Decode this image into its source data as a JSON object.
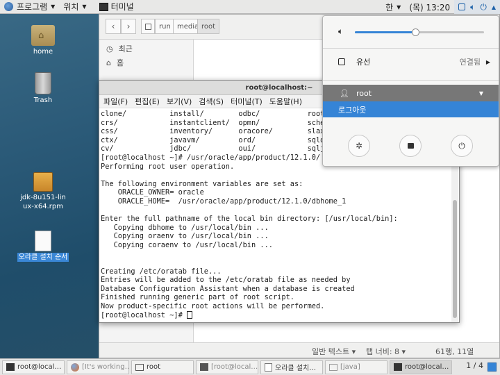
{
  "topbar": {
    "applications": "프로그램",
    "places": "위치",
    "active_app": "터미널",
    "input_method": "한",
    "clock": "(목) 13:20"
  },
  "desktop": {
    "icons": [
      {
        "label": "home",
        "icon": "folder-home-icon"
      },
      {
        "label": "Trash",
        "icon": "trash-icon"
      },
      {
        "label": "jdk-8u151-linux-x64.rpm",
        "icon": "package-icon"
      },
      {
        "label": "오라클 설치 순서",
        "icon": "document-icon"
      }
    ]
  },
  "file_manager": {
    "breadcrumbs": [
      "run",
      "media",
      "root"
    ],
    "sidebar": [
      {
        "label": "최근",
        "icon": "clock-icon"
      },
      {
        "label": "홈",
        "icon": "home-icon"
      }
    ],
    "status": {
      "mode": "일반 텍스트 ▾",
      "tab_width": "탭 너비: 8 ▾",
      "position": "61행, 11열"
    }
  },
  "terminal": {
    "title": "root@localhost:~",
    "menu": [
      "파일(F)",
      "편집(E)",
      "보기(V)",
      "검색(S)",
      "터미널(T)",
      "도움말(H)"
    ],
    "lines": [
      "clone/          install/        odbc/           root.s",
      "crs/            instantclient/  opmn/           schedu",
      "css/            inventory/      oracore/        slax/",
      "ctx/            javavm/         ord/            sqldev",
      "cv/             jdbc/           oui/            sqlj/",
      "[root@localhost ~]# /usr/oracle/app/product/12.1.0/",
      "Performing root user operation.",
      "",
      "The following environment variables are set as:",
      "    ORACLE_OWNER= oracle",
      "    ORACLE_HOME=  /usr/oracle/app/product/12.1.0/dbhome_1",
      "",
      "Enter the full pathname of the local bin directory: [/usr/local/bin]:",
      "   Copying dbhome to /usr/local/bin ...",
      "   Copying oraenv to /usr/local/bin ...",
      "   Copying coraenv to /usr/local/bin ...",
      "",
      "",
      "Creating /etc/oratab file...",
      "Entries will be added to the /etc/oratab file as needed by",
      "Database Configuration Assistant when a database is created",
      "Finished running generic part of root script.",
      "Now product-specific root actions will be performed."
    ],
    "prompt": "[root@localhost ~]# "
  },
  "system_menu": {
    "volume_fraction": 0.47,
    "network_label": "유선",
    "network_status": "연결됨",
    "user": "root",
    "logout": "로그아웃"
  },
  "taskbar": {
    "items": [
      {
        "label": "root@local…",
        "icon": "terminal-icon"
      },
      {
        "label": "[It's working…",
        "icon": "firefox-icon"
      },
      {
        "label": "root",
        "icon": "folder-icon"
      },
      {
        "label": "[root@local…",
        "icon": "terminal-icon"
      },
      {
        "label": "오라클 설치…",
        "icon": "text-editor-icon"
      },
      {
        "label": "[java]",
        "icon": "folder-icon"
      },
      {
        "label": "root@local…",
        "icon": "terminal-icon"
      }
    ],
    "workspace": "1 / 4"
  },
  "colors": {
    "accent": "#3584d6",
    "desktop": "#2b5a78"
  }
}
